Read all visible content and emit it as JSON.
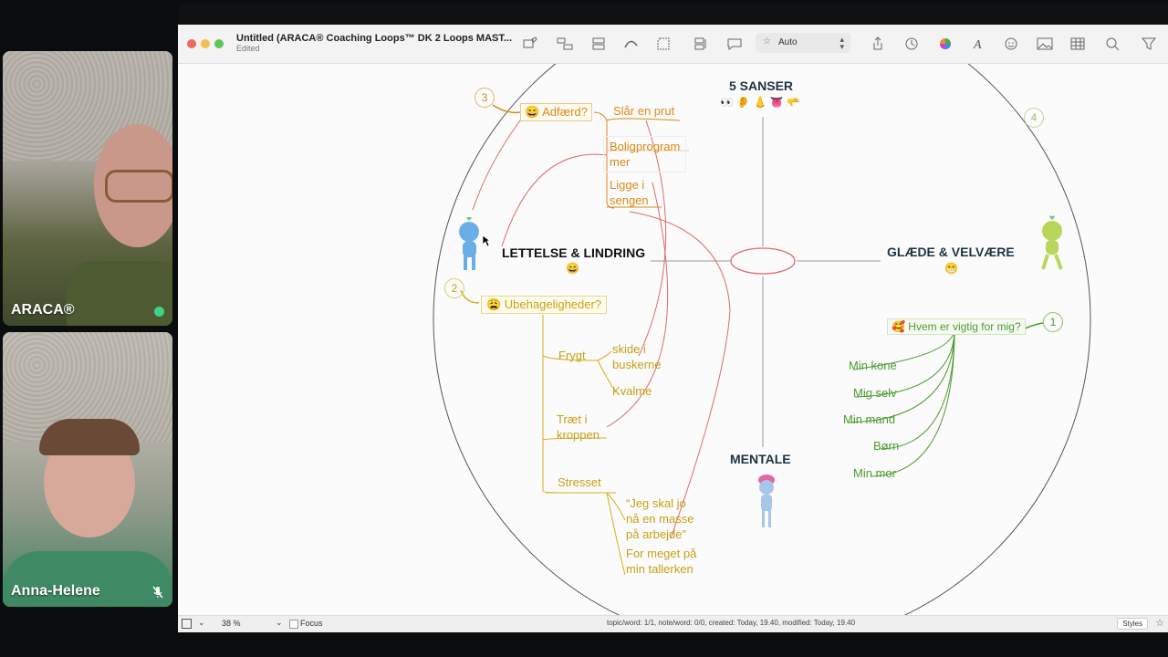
{
  "participants": [
    {
      "name": "ARACA®",
      "speaking": true
    },
    {
      "name": "Anna-Helene",
      "muted": true
    }
  ],
  "window": {
    "title": "Untitled (ARACA® Coaching Loops™ DK 2 Loops MAST...",
    "subtitle": "Edited",
    "style_select": "Auto",
    "toolbar_icons": [
      "new-topic-icon",
      "subtopic-icon",
      "callout-icon",
      "relationship-icon",
      "boundary-icon",
      "summary-icon",
      "comment-icon",
      "share-icon",
      "history-icon",
      "color-icon",
      "font-icon",
      "emoji-icon",
      "image-icon",
      "table-icon",
      "search-icon",
      "filter-icon"
    ]
  },
  "map": {
    "center": {
      "top": "5 SANSER",
      "top_emojis": "👀 👂 👃 👅 🫳",
      "left": "LETTELSE & LINDRING",
      "left_emoji": "😄",
      "right": "GLÆDE & VELVÆRE",
      "right_emoji": "😁",
      "bottom": "MENTALE"
    },
    "numbers": [
      "3",
      "4",
      "2",
      "1"
    ],
    "branch3": {
      "label": "😄 Adfærd?",
      "items": [
        "Slår en prut",
        "Boligprogram\nmer",
        "Ligge i\nsengen"
      ]
    },
    "branch2": {
      "label": "😩 Ubehageligheder?",
      "groups": [
        {
          "label": "Frygt",
          "items": [
            "skide i\nbuskerne",
            "Kvalme"
          ]
        },
        {
          "label": "Træt i\nkroppen",
          "items": []
        },
        {
          "label": "Stresset",
          "items": [
            "“Jeg skal jo\nnå en masse\npå arbejde”",
            "For meget på\nmin tallerken"
          ]
        }
      ]
    },
    "branch1": {
      "label": "🥰 Hvem er vigtig for mig?",
      "items": [
        "Min kone",
        "Mig selv",
        "Min mand",
        "Børn",
        "Min mor"
      ]
    }
  },
  "status": {
    "zoom": "38 %",
    "focus": "Focus",
    "info": "topic/word: 1/1, note/word: 0/0, created: Today, 19.40, modified: Today, 19.40",
    "styles": "Styles"
  }
}
